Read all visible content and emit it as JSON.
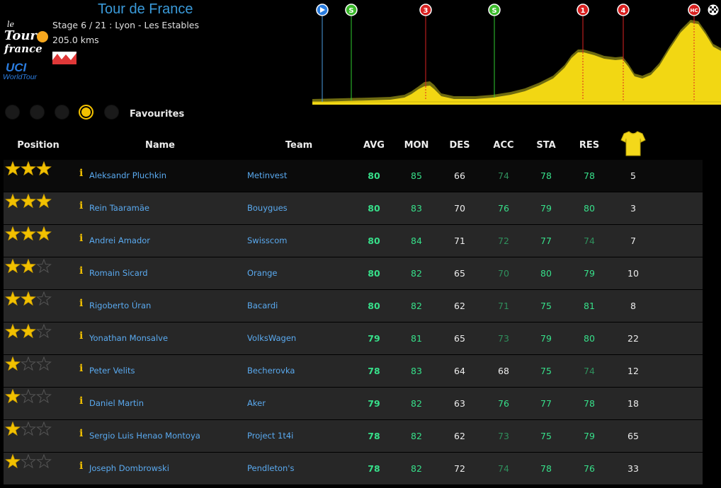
{
  "header": {
    "race_title": "Tour de France",
    "stage_line": "Stage 6 / 21 : Lyon - Les Estables",
    "distance": "205.0 kms",
    "logo_text": "Le Tour de France",
    "tour_badge": "UCI WorldTour"
  },
  "profile": {
    "markers": [
      {
        "label": "▶",
        "kind": "start"
      },
      {
        "label": "S",
        "kind": "sprint"
      },
      {
        "label": "3",
        "kind": "climb"
      },
      {
        "label": "S",
        "kind": "sprint"
      },
      {
        "label": "1",
        "kind": "climb"
      },
      {
        "label": "4",
        "kind": "climb"
      },
      {
        "label": "HC",
        "kind": "climb"
      },
      {
        "label": "finish",
        "kind": "finish"
      }
    ]
  },
  "filters": {
    "label": "Favourites",
    "active_index": 3,
    "count": 5
  },
  "table": {
    "headers": {
      "position": "Position",
      "name": "Name",
      "team": "Team",
      "avg": "AVG",
      "mon": "MON",
      "des": "DES",
      "acc": "ACC",
      "sta": "STA",
      "res": "RES",
      "jersey": "yellow-jersey-icon"
    },
    "rows": [
      {
        "stars": 3,
        "name": "Aleksandr Pluchkin",
        "team": "Metinvest",
        "avg": 80,
        "mon": 85,
        "des": 66,
        "acc": 74,
        "sta": 78,
        "res": 78,
        "rank": 5
      },
      {
        "stars": 3,
        "name": "Rein Taaramäe",
        "team": "Bouygues",
        "avg": 80,
        "mon": 83,
        "des": 70,
        "acc": 76,
        "sta": 79,
        "res": 80,
        "rank": 3
      },
      {
        "stars": 3,
        "name": "Andrei Amador",
        "team": "Swisscom",
        "avg": 80,
        "mon": 84,
        "des": 71,
        "acc": 72,
        "sta": 77,
        "res": 74,
        "rank": 7
      },
      {
        "stars": 2,
        "name": "Romain Sicard",
        "team": "Orange",
        "avg": 80,
        "mon": 82,
        "des": 65,
        "acc": 70,
        "sta": 80,
        "res": 79,
        "rank": 10
      },
      {
        "stars": 2,
        "name": "Rigoberto Úran",
        "team": "Bacardi",
        "avg": 80,
        "mon": 82,
        "des": 62,
        "acc": 71,
        "sta": 75,
        "res": 81,
        "rank": 8
      },
      {
        "stars": 2,
        "name": "Yonathan Monsalve",
        "team": "VolksWagen",
        "avg": 79,
        "mon": 81,
        "des": 65,
        "acc": 73,
        "sta": 79,
        "res": 80,
        "rank": 22
      },
      {
        "stars": 1,
        "name": "Peter Velits",
        "team": "Becherovka",
        "avg": 78,
        "mon": 83,
        "des": 64,
        "acc": 68,
        "sta": 75,
        "res": 74,
        "rank": 12
      },
      {
        "stars": 1,
        "name": "Daniel Martin",
        "team": "Aker",
        "avg": 79,
        "mon": 82,
        "des": 63,
        "acc": 76,
        "sta": 77,
        "res": 78,
        "rank": 18
      },
      {
        "stars": 1,
        "name": "Sergio Luis Henao Montoya",
        "team": "Project 1t4i",
        "avg": 78,
        "mon": 82,
        "des": 62,
        "acc": 73,
        "sta": 75,
        "res": 79,
        "rank": 65
      },
      {
        "stars": 1,
        "name": "Joseph Dombrowski",
        "team": "Pendleton's",
        "avg": 78,
        "mon": 82,
        "des": 72,
        "acc": 74,
        "sta": 78,
        "res": 76,
        "rank": 33
      }
    ]
  },
  "colors": {
    "accent_blue": "#3a9ad9",
    "link_blue": "#5aaaf0",
    "gold": "#f2c100",
    "stat_green": "#37e08a",
    "stat_dim_green": "#2f8f5c"
  }
}
